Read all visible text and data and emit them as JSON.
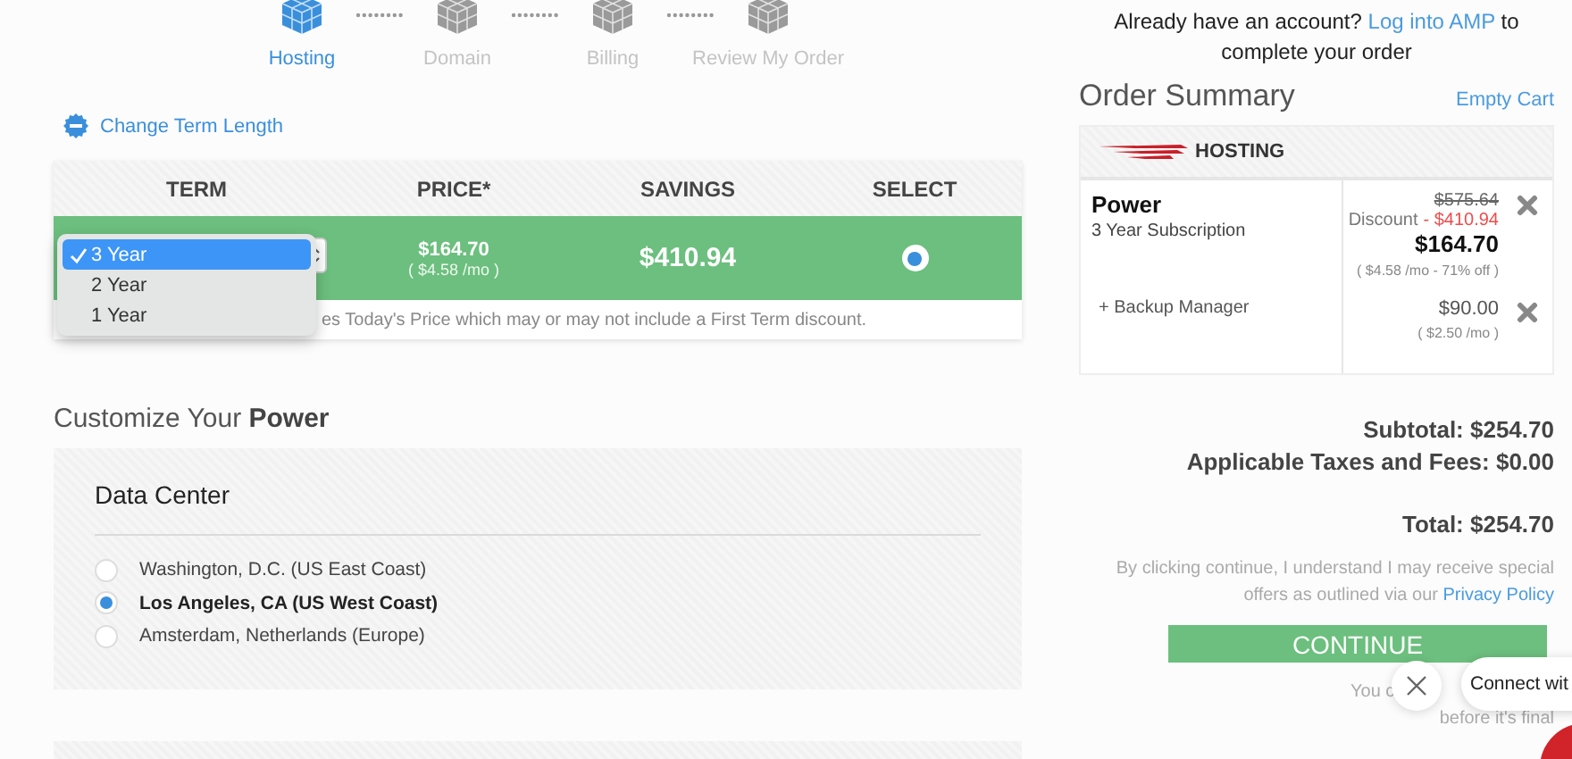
{
  "steps": [
    {
      "label": "Hosting",
      "selected": true
    },
    {
      "label": "Domain",
      "selected": false
    },
    {
      "label": "Billing",
      "selected": false
    },
    {
      "label": "Review My Order",
      "selected": false
    }
  ],
  "change_term": {
    "label": "Change Term Length"
  },
  "term_table": {
    "columns": [
      "TERM",
      "PRICE*",
      "SAVINGS",
      "SELECT"
    ],
    "rows": [
      {
        "term_options": [
          {
            "label": "3 Year",
            "selected": true
          },
          {
            "label": "2 Year",
            "selected": false
          },
          {
            "label": "1 Year",
            "selected": false
          }
        ],
        "price": "$164.70",
        "price_monthly": "( $4.58 /mo )",
        "savings": "$410.94",
        "selected": true
      }
    ],
    "note": "es Today's Price which may or may not include a First Term discount."
  },
  "customize": {
    "heading": "Customize Your **Power**",
    "panel": {
      "title": "Data Center",
      "options": [
        {
          "label": "Washington, D.C. (US East Coast)",
          "selected": false
        },
        {
          "label": "Los Angeles, CA (US West Coast)",
          "selected": true
        },
        {
          "label": "Amsterdam, Netherlands (Europe)",
          "selected": false
        }
      ]
    }
  },
  "account_prompt": {
    "text": "Already have an account?",
    "link": "Log into AMP",
    "after": "to complete your order"
  },
  "order_summary": {
    "title": "Order Summary",
    "empty_cart": "Empty Cart",
    "category": "HOSTING",
    "items": [
      {
        "kind": "product",
        "name": "Power",
        "subtitle": "3 Year Subscription",
        "original_price": "$575.64",
        "discount_label": "Discount",
        "discount": "- $410.94",
        "price": "$164.70",
        "price_note": "( $4.58 /mo - 71% off )"
      },
      {
        "kind": "addon",
        "name": "+ Backup Manager",
        "price": "$90.00",
        "price_note": "( $2.50 /mo )"
      }
    ]
  },
  "totals": {
    "subtotal": "Subtotal: $254.70",
    "taxes": "Applicable Taxes and Fees: $0.00",
    "total": "Total: $254.70"
  },
  "consent": {
    "text": "By clicking continue, I understand I may receive special offers as outlined via our",
    "link": "Privacy Policy"
  },
  "continue_button": "CONTINUE",
  "footnote": [
    "You c",
    "before it's final"
  ],
  "chat": {
    "prompt": "Connect wit"
  }
}
